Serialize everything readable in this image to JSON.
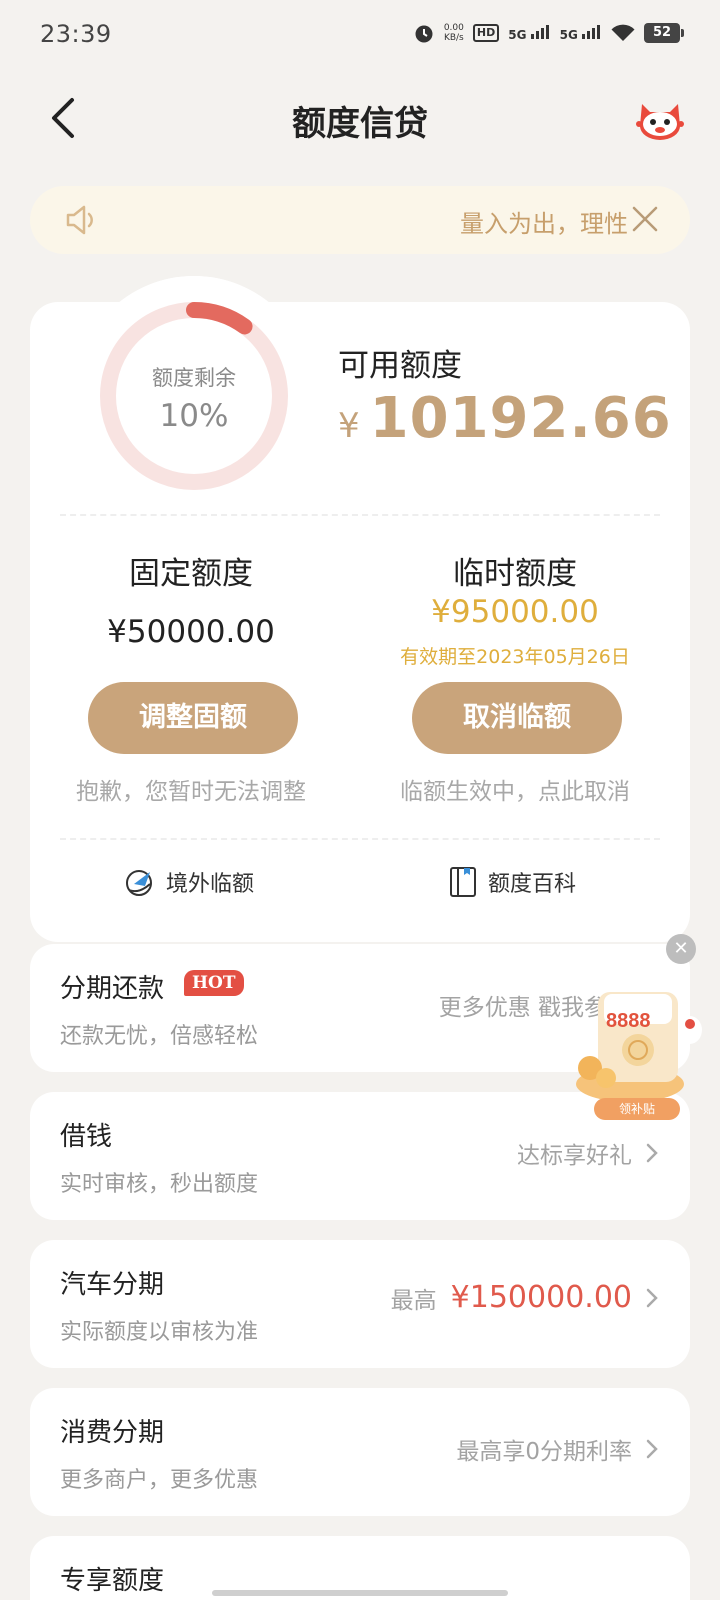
{
  "status_bar": {
    "time": "23:39",
    "net_speed_value": "0.00",
    "net_speed_unit": "KB/s",
    "hd_label": "HD",
    "signal_1": "5G",
    "signal_2": "5G",
    "battery": "52"
  },
  "header": {
    "title": "额度信贷"
  },
  "notice": {
    "text": "量入为出，理性"
  },
  "credit": {
    "ring_label": "额度剩余",
    "ring_value": "10%",
    "remaining_fraction": 0.1,
    "available_label": "可用额度",
    "currency": "¥",
    "available_amount": "10192.66",
    "fixed": {
      "title": "固定额度",
      "amount": "¥50000.00",
      "button": "调整固额",
      "note": "抱歉，您暂时无法调整"
    },
    "temporary": {
      "title": "临时额度",
      "amount": "¥95000.00",
      "validity": "有效期至2023年05月26日",
      "button": "取消临额",
      "note": "临额生效中，点此取消"
    },
    "links": {
      "overseas": "境外临额",
      "encyclopedia": "额度百科"
    }
  },
  "list": [
    {
      "title": "分期还款",
      "badge": "HOT",
      "subtitle": "还款无忧，倍感轻松",
      "right": "更多优惠 戳我参与"
    },
    {
      "title": "借钱",
      "subtitle": "实时审核，秒出额度",
      "right": "达标享好礼"
    },
    {
      "title": "汽车分期",
      "subtitle": "实际额度以审核为准",
      "right_prefix": "最高",
      "right_amount": "¥150000.00"
    },
    {
      "title": "消费分期",
      "subtitle": "更多商户，更多优惠",
      "right": "最高享0分期利率"
    },
    {
      "title": "专享额度"
    }
  ],
  "promo": {
    "number": "8888",
    "tag": "领补贴"
  },
  "colors": {
    "accent": "#c9a47b",
    "gold_text": "#c4a27a",
    "temp_yellow": "#dfae3c",
    "hot_red": "#e34f43",
    "ring_red": "#e36a5f",
    "background": "#f4f2ef"
  }
}
